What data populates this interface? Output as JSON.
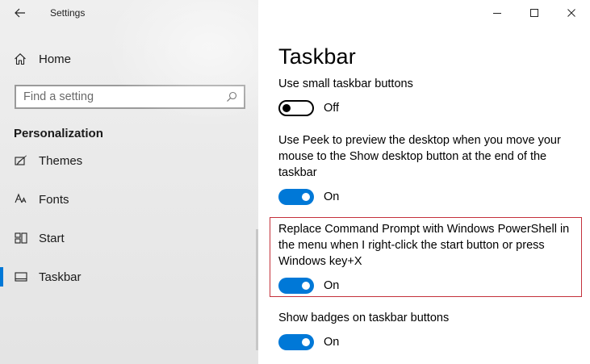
{
  "window": {
    "title": "Settings",
    "controls": {
      "minimize": "minimize-icon",
      "maximize": "maximize-icon",
      "close": "close-icon"
    }
  },
  "sidebar": {
    "home_label": "Home",
    "search_placeholder": "Find a setting",
    "section_title": "Personalization",
    "items": [
      {
        "label": "Themes",
        "icon": "themes-icon",
        "active": false
      },
      {
        "label": "Fonts",
        "icon": "fonts-icon",
        "active": false
      },
      {
        "label": "Start",
        "icon": "start-icon",
        "active": false
      },
      {
        "label": "Taskbar",
        "icon": "taskbar-icon",
        "active": true
      }
    ]
  },
  "main": {
    "page_title": "Taskbar",
    "settings": [
      {
        "text": "Use small taskbar buttons",
        "state": "Off",
        "on": false
      },
      {
        "text": "Use Peek to preview the desktop when you move your mouse to the Show desktop button at the end of the taskbar",
        "state": "On",
        "on": true
      },
      {
        "text": "Replace Command Prompt with Windows PowerShell in the menu when I right-click the start button or press Windows key+X",
        "state": "On",
        "on": true,
        "highlighted": true
      },
      {
        "text": "Show badges on taskbar buttons",
        "state": "On",
        "on": true
      }
    ]
  },
  "colors": {
    "accent": "#0078d7",
    "highlight_border": "#c4313b"
  }
}
